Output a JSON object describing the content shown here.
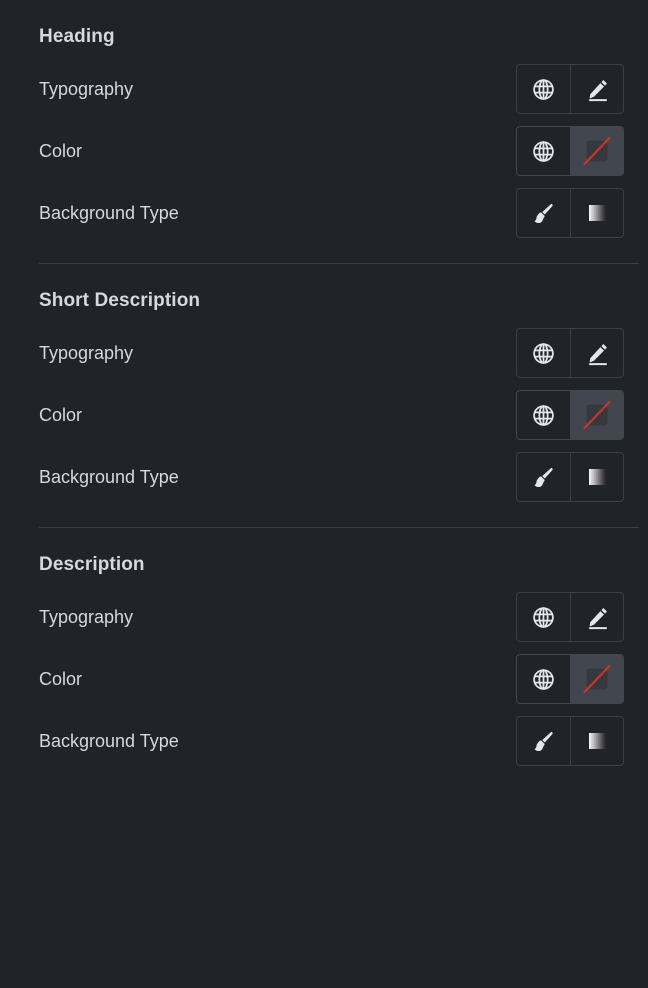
{
  "theme": {
    "background": "#202428",
    "text_primary": "#d5d8dc",
    "border": "#3b4046",
    "active_cell_background": "#42474f",
    "swatch_slash": "#d93025",
    "swatch_inner": "#34383f"
  },
  "sections": [
    {
      "title": "Heading",
      "rows": [
        {
          "label": "Typography",
          "buttons": [
            {
              "icon": "globe-icon",
              "active": false
            },
            {
              "icon": "pencil-edit-icon",
              "active": false
            }
          ]
        },
        {
          "label": "Color",
          "buttons": [
            {
              "icon": "globe-icon",
              "active": false
            },
            {
              "icon": "no-color-swatch-icon",
              "active": true
            }
          ]
        },
        {
          "label": "Background Type",
          "buttons": [
            {
              "icon": "paint-brush-icon",
              "active": false
            },
            {
              "icon": "gradient-icon",
              "active": false
            }
          ]
        }
      ]
    },
    {
      "title": "Short Description",
      "rows": [
        {
          "label": "Typography",
          "buttons": [
            {
              "icon": "globe-icon",
              "active": false
            },
            {
              "icon": "pencil-edit-icon",
              "active": false
            }
          ]
        },
        {
          "label": "Color",
          "buttons": [
            {
              "icon": "globe-icon",
              "active": false
            },
            {
              "icon": "no-color-swatch-icon",
              "active": true
            }
          ]
        },
        {
          "label": "Background Type",
          "buttons": [
            {
              "icon": "paint-brush-icon",
              "active": false
            },
            {
              "icon": "gradient-icon",
              "active": false
            }
          ]
        }
      ]
    },
    {
      "title": "Description",
      "rows": [
        {
          "label": "Typography",
          "buttons": [
            {
              "icon": "globe-icon",
              "active": false
            },
            {
              "icon": "pencil-edit-icon",
              "active": false
            }
          ]
        },
        {
          "label": "Color",
          "buttons": [
            {
              "icon": "globe-icon",
              "active": false
            },
            {
              "icon": "no-color-swatch-icon",
              "active": true
            }
          ]
        },
        {
          "label": "Background Type",
          "buttons": [
            {
              "icon": "paint-brush-icon",
              "active": false
            },
            {
              "icon": "gradient-icon",
              "active": false
            }
          ]
        }
      ]
    }
  ]
}
